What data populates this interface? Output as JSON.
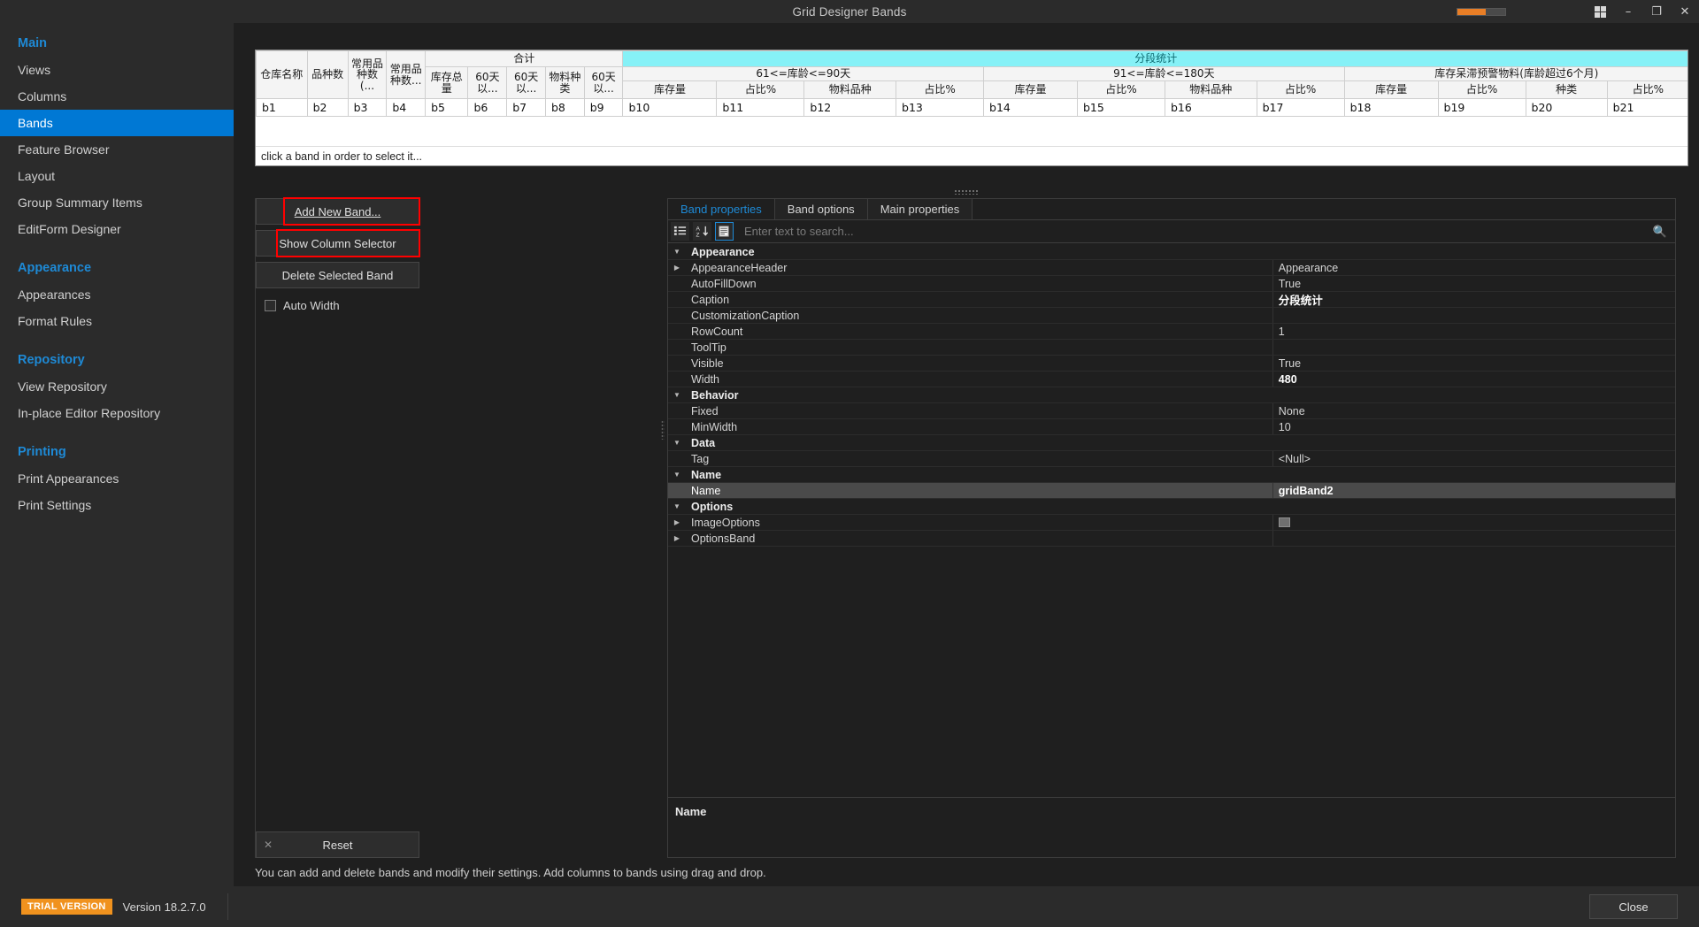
{
  "window": {
    "title": "Grid Designer Bands",
    "minimize": "–",
    "maximize": "❐",
    "close": "✕",
    "grid_icon": "grid-icon",
    "progress_percent": 60
  },
  "sidebar": {
    "groups": [
      {
        "label": "Main",
        "items": [
          {
            "label": "Views",
            "active": false
          },
          {
            "label": "Columns",
            "active": false
          },
          {
            "label": "Bands",
            "active": true
          },
          {
            "label": "Feature Browser",
            "active": false
          },
          {
            "label": "Layout",
            "active": false
          },
          {
            "label": "Group Summary Items",
            "active": false
          },
          {
            "label": "EditForm Designer",
            "active": false
          }
        ]
      },
      {
        "label": "Appearance",
        "items": [
          {
            "label": "Appearances",
            "active": false
          },
          {
            "label": "Format Rules",
            "active": false
          }
        ]
      },
      {
        "label": "Repository",
        "items": [
          {
            "label": "View Repository",
            "active": false
          },
          {
            "label": "In-place Editor Repository",
            "active": false
          }
        ]
      },
      {
        "label": "Printing",
        "items": [
          {
            "label": "Print Appearances",
            "active": false
          },
          {
            "label": "Print Settings",
            "active": false
          }
        ]
      }
    ]
  },
  "band_preview": {
    "hint": "click a band in order to select it...",
    "top_bands": [
      {
        "caption": "合计",
        "cyan": false
      },
      {
        "caption": "分段统计",
        "cyan": true
      }
    ],
    "second_bands": [
      {
        "caption": "61<=库龄<=90天"
      },
      {
        "caption": "91<=库龄<=180天"
      },
      {
        "caption": "库存呆滞预警物料(库龄超过6个月)"
      }
    ],
    "leaf_columns": [
      "仓库名称",
      "品种数",
      "常用品种数(...",
      "常用品种数...",
      "库存总量",
      "60天以...",
      "60天以...",
      "物料种类",
      "60天以...",
      "库存量",
      "占比%",
      "物料品种",
      "占比%",
      "库存量",
      "占比%",
      "物料品种",
      "占比%",
      "库存量",
      "占比%",
      "种类",
      "占比%"
    ],
    "band_names": [
      "b1",
      "b2",
      "b3",
      "b4",
      "b5",
      "b6",
      "b7",
      "b8",
      "b9",
      "b10",
      "b11",
      "b12",
      "b13",
      "b14",
      "b15",
      "b16",
      "b17",
      "b18",
      "b19",
      "b20",
      "b21"
    ]
  },
  "commands": {
    "add_new_band": "Add New Band...",
    "show_column_selector": "Show Column Selector",
    "delete_selected_band": "Delete Selected Band",
    "auto_width": "Auto Width",
    "auto_width_checked": false,
    "reset": "Reset",
    "reset_x": "✕"
  },
  "property_panel": {
    "tabs": [
      {
        "label": "Band properties",
        "active": true
      },
      {
        "label": "Band options",
        "active": false
      },
      {
        "label": "Main properties",
        "active": false
      }
    ],
    "toolbar": [
      {
        "name": "categorized-icon",
        "glyph": "categorized",
        "active": false
      },
      {
        "name": "sort-alphabetical-icon",
        "glyph": "sort-az",
        "active": false
      },
      {
        "name": "property-pages-icon",
        "glyph": "pages",
        "active": true
      }
    ],
    "search_placeholder": "Enter text to search...",
    "search_value": "",
    "search_icon": "search-icon",
    "rows": [
      {
        "kind": "category",
        "name": "Appearance",
        "value": "",
        "expander": "▼"
      },
      {
        "kind": "prop",
        "name": "AppearanceHeader",
        "value": "Appearance",
        "expander": "▶",
        "bold": false
      },
      {
        "kind": "prop",
        "name": "AutoFillDown",
        "value": "True",
        "expander": "",
        "bold": false
      },
      {
        "kind": "prop",
        "name": "Caption",
        "value": "分段统计",
        "expander": "",
        "bold": true
      },
      {
        "kind": "prop",
        "name": "CustomizationCaption",
        "value": "",
        "expander": "",
        "bold": false
      },
      {
        "kind": "prop",
        "name": "RowCount",
        "value": "1",
        "expander": "",
        "bold": false
      },
      {
        "kind": "prop",
        "name": "ToolTip",
        "value": "",
        "expander": "",
        "bold": false
      },
      {
        "kind": "prop",
        "name": "Visible",
        "value": "True",
        "expander": "",
        "bold": false
      },
      {
        "kind": "prop",
        "name": "Width",
        "value": "480",
        "expander": "",
        "bold": true
      },
      {
        "kind": "category",
        "name": "Behavior",
        "value": "",
        "expander": "▼"
      },
      {
        "kind": "prop",
        "name": "Fixed",
        "value": "None",
        "expander": "",
        "bold": false
      },
      {
        "kind": "prop",
        "name": "MinWidth",
        "value": "10",
        "expander": "",
        "bold": false
      },
      {
        "kind": "category",
        "name": "Data",
        "value": "",
        "expander": "▼"
      },
      {
        "kind": "prop",
        "name": "Tag",
        "value": "<Null>",
        "expander": "",
        "bold": false
      },
      {
        "kind": "category",
        "name": "Name",
        "value": "",
        "expander": "▼"
      },
      {
        "kind": "prop",
        "name": "Name",
        "value": "gridBand2",
        "expander": "",
        "bold": true,
        "selected": true
      },
      {
        "kind": "category",
        "name": "Options",
        "value": "",
        "expander": "▼"
      },
      {
        "kind": "prop",
        "name": "ImageOptions",
        "value": "",
        "expander": "▶",
        "bold": false,
        "colorchip": true
      },
      {
        "kind": "prop",
        "name": "OptionsBand",
        "value": "",
        "expander": "▶",
        "bold": false
      }
    ],
    "footer_title": "Name",
    "footer_description": ""
  },
  "hint_text": "You can add and delete bands and modify their settings. Add columns to bands using drag and drop.",
  "statusbar": {
    "trial_badge": "TRIAL VERSION",
    "version": "Version 18.2.7.0",
    "close_button": "Close"
  },
  "colors": {
    "accent": "#0078d4",
    "group_header": "#1e8ad6",
    "cyan_band": "#86f1f7",
    "highlight_box": "#ff0000",
    "trial_badge": "#f0921e",
    "progress": "#e87e26"
  }
}
